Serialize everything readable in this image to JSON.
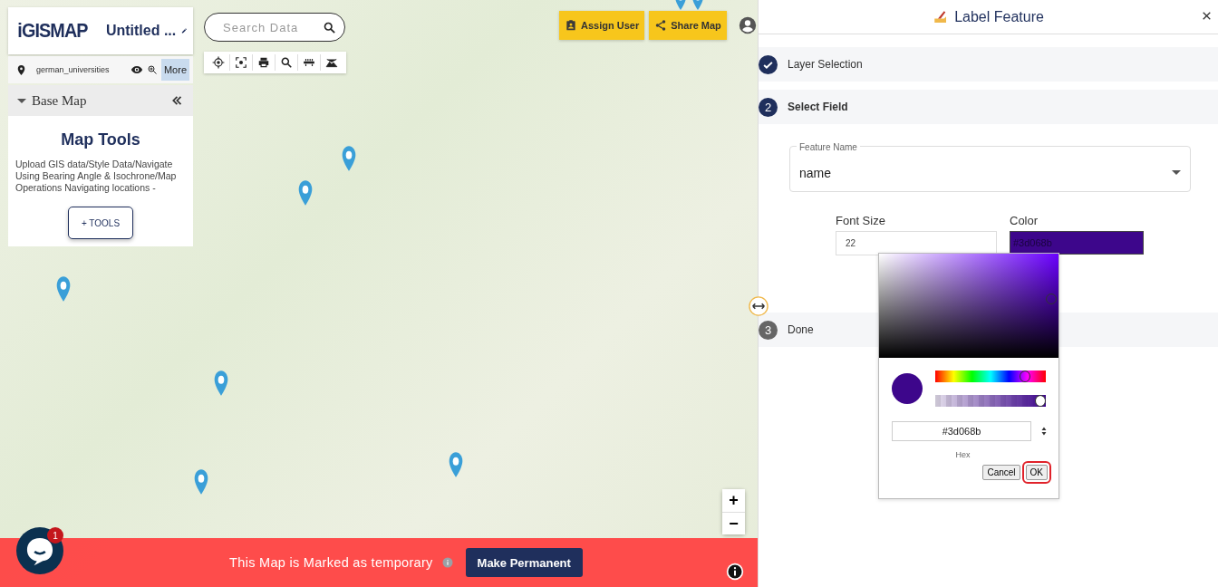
{
  "header": {
    "logo": "iGISMAP",
    "map_title": "Untitled ..."
  },
  "search": {
    "placeholder": "Search Data"
  },
  "layer": {
    "name": "german_universities",
    "more": "More"
  },
  "base_map": {
    "label": "Base Map"
  },
  "map_tools": {
    "title": "Map Tools",
    "description": "Upload GIS data/Style Data/Navigate Using Bearing Angle & Isochrone/Map Operations Navigating locations -",
    "button": "+ TOOLS"
  },
  "top_buttons": [
    {
      "kind": "assign",
      "label": "Assign User"
    },
    {
      "kind": "share",
      "label": "Share Map"
    }
  ],
  "zoom": [
    "+",
    "−"
  ],
  "banner": {
    "text": "This Map is Marked as temporary",
    "button": "Make Permanent"
  },
  "chat": {
    "badge": "1"
  },
  "panel": {
    "title": "Label Feature",
    "steps": [
      {
        "kind": "done",
        "label": "Layer Selection"
      },
      {
        "kind": "active",
        "number": "2",
        "label": "Select Field"
      },
      {
        "kind": "pending",
        "number": "3",
        "label": "Done"
      }
    ],
    "feature_field": {
      "label": "Feature Name",
      "value": "name"
    },
    "font_size": {
      "label": "Font Size",
      "value": "22"
    },
    "color": {
      "label": "Color",
      "value": "#3d068b"
    }
  },
  "picker": {
    "hex": "#3d068b",
    "hex_label": "Hex",
    "hue": {
      "level": 0.86
    },
    "alpha": {
      "level": 1
    },
    "buttons": [
      "Cancel",
      "OK"
    ]
  }
}
